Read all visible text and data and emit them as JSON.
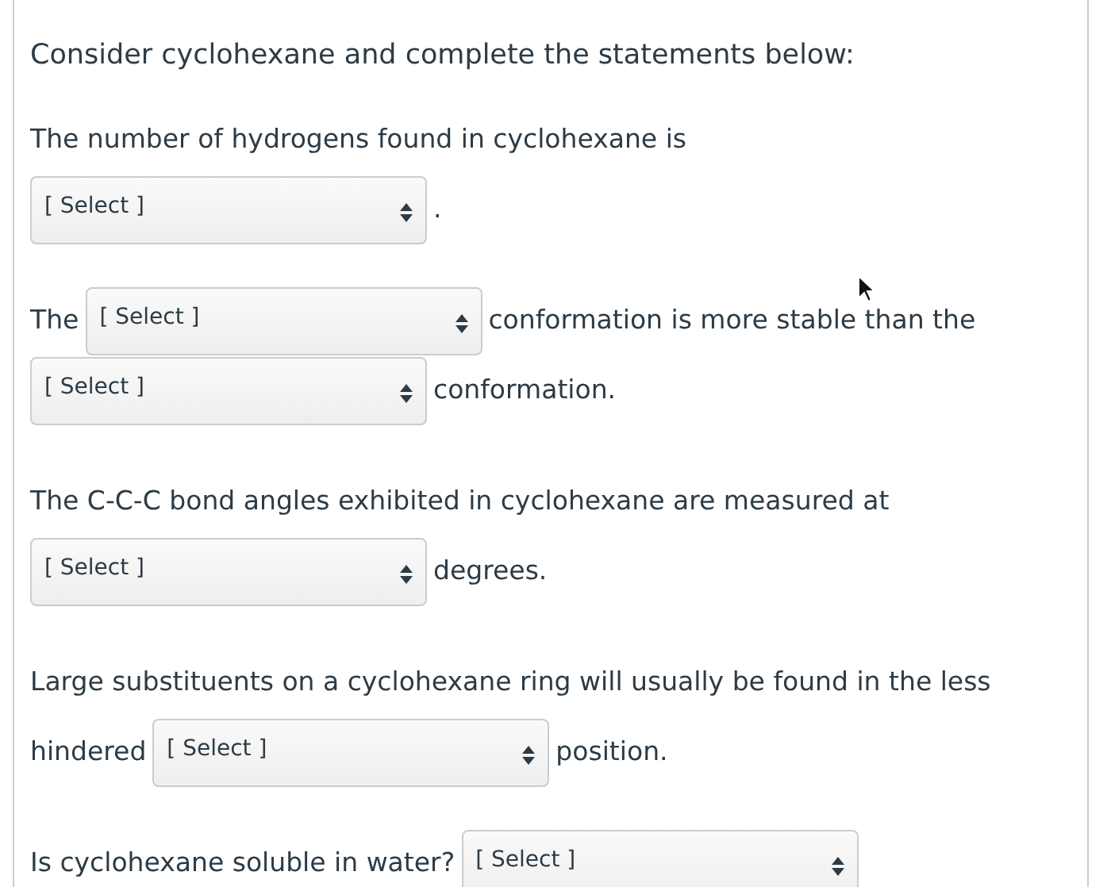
{
  "intro": "Consider cyclohexane and complete the statements below:",
  "questions": [
    {
      "lines": [
        [
          {
            "kind": "text",
            "text": "The number of hydrogens found in cyclohexane is"
          }
        ],
        [
          {
            "kind": "select",
            "value": "[ Select ]"
          },
          {
            "kind": "text",
            "text": "."
          }
        ]
      ]
    },
    {
      "lines": [
        [
          {
            "kind": "text",
            "text": "The"
          },
          {
            "kind": "select",
            "value": "[ Select ]"
          },
          {
            "kind": "text",
            "text": "conformation is more stable than the"
          }
        ],
        [
          {
            "kind": "select",
            "value": "[ Select ]"
          },
          {
            "kind": "text",
            "text": "conformation."
          }
        ]
      ]
    },
    {
      "lines": [
        [
          {
            "kind": "text",
            "text": "The C-C-C bond angles exhibited in cyclohexane are measured at"
          }
        ],
        [
          {
            "kind": "select",
            "value": "[ Select ]"
          },
          {
            "kind": "text",
            "text": "degrees."
          }
        ]
      ]
    },
    {
      "lines": [
        [
          {
            "kind": "text",
            "text": "Large substituents on a cyclohexane ring will usually be found in the less"
          }
        ],
        [
          {
            "kind": "text",
            "text": "hindered"
          },
          {
            "kind": "select",
            "value": "[ Select ]"
          },
          {
            "kind": "text",
            "text": "position."
          }
        ]
      ]
    },
    {
      "lines": [
        [
          {
            "kind": "text",
            "text": "Is cyclohexane soluble in water?"
          },
          {
            "kind": "select",
            "value": "[ Select ]"
          }
        ]
      ]
    }
  ]
}
